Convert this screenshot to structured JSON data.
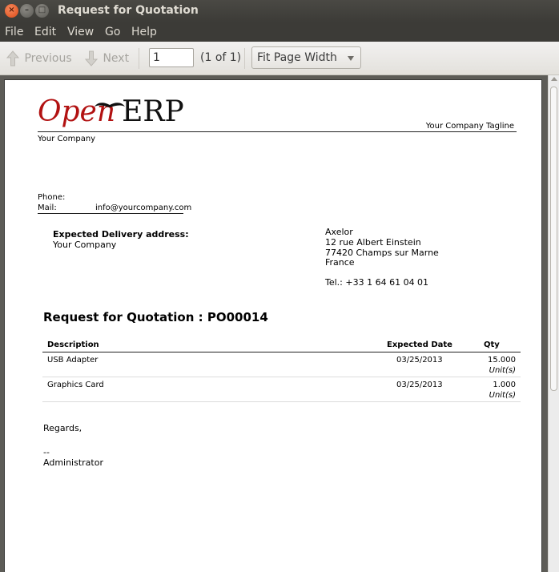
{
  "window": {
    "title": "Request for Quotation",
    "close_glyph": "×",
    "min_glyph": "–",
    "max_glyph": "□"
  },
  "menu": [
    "File",
    "Edit",
    "View",
    "Go",
    "Help"
  ],
  "toolbar": {
    "previous_label": "Previous",
    "next_label": "Next",
    "page_value": "1",
    "page_count": "(1 of 1)",
    "zoom_value": "Fit Page Width"
  },
  "document": {
    "logo_open": "Open",
    "logo_erp": "ERP",
    "tagline": "Your Company Tagline",
    "company": "Your Company",
    "phone_label": "Phone:",
    "mail_label": "Mail:",
    "mail_value": "info@yourcompany.com",
    "delivery_title": "Expected Delivery address:",
    "delivery_name": "Your Company",
    "supplier": {
      "name": "Axelor",
      "street": "12 rue Albert Einstein",
      "city": "77420 Champs sur Marne",
      "country": "France",
      "tel": "Tel.: +33 1 64 61 04 01"
    },
    "title": "Request for Quotation : PO00014",
    "table": {
      "headers": {
        "description": "Description",
        "expected_date": "Expected Date",
        "qty": "Qty"
      },
      "rows": [
        {
          "description": "USB Adapter",
          "date": "03/25/2013",
          "qty": "15.000",
          "unit": "Unit(s)"
        },
        {
          "description": "Graphics Card",
          "date": "03/25/2013",
          "qty": "1.000",
          "unit": "Unit(s)"
        }
      ]
    },
    "regards": "Regards,",
    "signature_dashes": "--",
    "signer": "Administrator"
  },
  "colors": {
    "logo_red": "#b21212",
    "titlebar": "#3c3b37",
    "close_button": "#df4a16"
  }
}
